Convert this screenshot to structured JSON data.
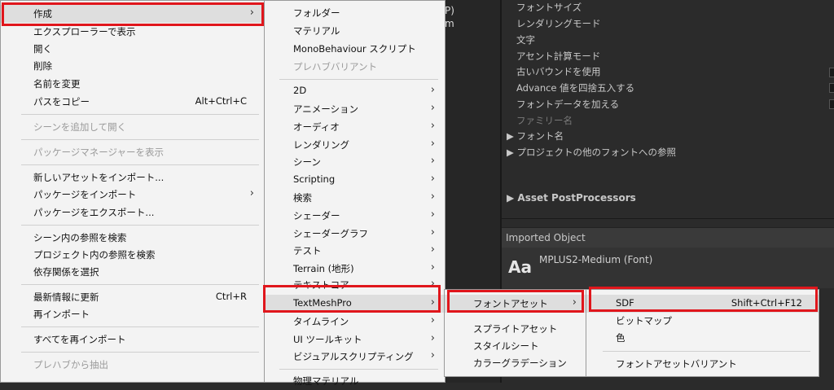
{
  "inspector": {
    "rows": [
      "フォントサイズ",
      "レンダリングモード",
      "文字",
      "アセント計算モード",
      "古いバウンドを使用",
      "Advance 値を四捨五入する",
      "フォントデータを加える",
      "ファミリー名"
    ],
    "foldouts": [
      "▶ フォント名",
      "▶ プロジェクトの他のフォントへの参照"
    ],
    "asset_post": "▶  Asset PostProcessors",
    "imported_header": "Imported Object",
    "imported_name": "MPLUS2-Medium (Font)",
    "aa_icon": "Aa",
    "left_partial_1": "P)",
    "left_partial_2": "m"
  },
  "menu1": {
    "create": "作成",
    "show_explorer": "エクスプローラーで表示",
    "open": "開く",
    "delete": "削除",
    "rename": "名前を変更",
    "copy_path": "パスをコピー",
    "copy_path_sc": "Alt+Ctrl+C",
    "add_scene": "シーンを追加して開く",
    "pkg_manager": "パッケージマネージャーを表示",
    "import_new": "新しいアセットをインポート...",
    "import_pkg": "パッケージをインポート",
    "export_pkg": "パッケージをエクスポート...",
    "find_scene_ref": "シーン内の参照を検索",
    "find_project_ref": "プロジェクト内の参照を検索",
    "select_deps": "依存関係を選択",
    "refresh": "最新情報に更新",
    "refresh_sc": "Ctrl+R",
    "reimport": "再インポート",
    "reimport_all": "すべてを再インポート",
    "extract_prefab": "プレハブから抽出"
  },
  "menu2": {
    "folder": "フォルダー",
    "material": "マテリアル",
    "mono": "MonoBehaviour スクリプト",
    "prefab_variant": "プレハブバリアント",
    "d2": "2D",
    "animation": "アニメーション",
    "audio": "オーディオ",
    "rendering": "レンダリング",
    "scene": "シーン",
    "scripting": "Scripting",
    "search": "検索",
    "shader": "シェーダー",
    "shader_graph": "シェーダーグラフ",
    "test": "テスト",
    "terrain": "Terrain (地形)",
    "text_core": "テキストコア",
    "tmp": "TextMeshPro",
    "timeline": "タイムライン",
    "ui_toolkit": "UI ツールキット",
    "visual_scripting": "ビジュアルスクリプティング",
    "physics_material": "物理マテリアル"
  },
  "menu3": {
    "font_asset": "フォントアセット",
    "sprite_asset": "スプライトアセット",
    "style_sheet": "スタイルシート",
    "color_gradient": "カラーグラデーション"
  },
  "menu4": {
    "sdf": "SDF",
    "sdf_sc": "Shift+Ctrl+F12",
    "bitmap": "ビットマップ",
    "color": "色",
    "font_asset_variant": "フォントアセットバリアント"
  },
  "arrow": "›",
  "colors": {
    "highlight": "#e0161c",
    "menu_bg": "#f3f3f3",
    "editor_bg": "#2b2b2b"
  }
}
